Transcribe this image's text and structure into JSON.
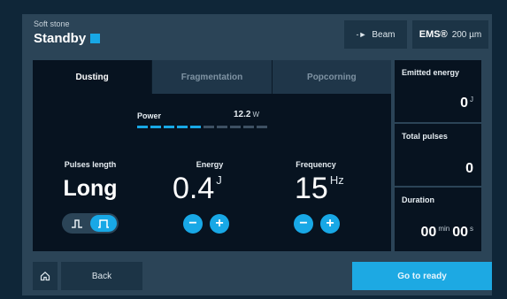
{
  "header": {
    "subtitle": "Soft stone",
    "status": "Standby",
    "beam_label": "Beam",
    "ems_logo": "EMS®",
    "fiber_size": "200 µm"
  },
  "tabs": [
    {
      "label": "Dusting",
      "active": true
    },
    {
      "label": "Fragmentation",
      "active": false
    },
    {
      "label": "Popcorning",
      "active": false
    }
  ],
  "power": {
    "label": "Power",
    "value": "12.2",
    "unit": "W",
    "segments_total": 10,
    "segments_on": 5
  },
  "pulse_length": {
    "label": "Pulses length",
    "value": "Long",
    "options": [
      "short-pulse",
      "long-pulse"
    ],
    "selected": "long-pulse"
  },
  "energy": {
    "label": "Energy",
    "value": "0.4",
    "unit": "J"
  },
  "frequency": {
    "label": "Frequency",
    "value": "15",
    "unit": "Hz"
  },
  "stats": {
    "emitted_energy": {
      "label": "Emitted energy",
      "value": "0",
      "unit": "J"
    },
    "total_pulses": {
      "label": "Total pulses",
      "value": "0"
    },
    "duration": {
      "label": "Duration",
      "minutes": "00",
      "min_unit": "min",
      "seconds": "00",
      "sec_unit": "s"
    }
  },
  "footer": {
    "back_label": "Back",
    "ready_label": "Go to ready"
  },
  "colors": {
    "accent": "#18a8e6",
    "background": "#2b4457",
    "panel": "#071320"
  },
  "icons": {
    "home": "home-icon",
    "beam": "beam-arrow-icon",
    "minus": "minus-icon",
    "plus": "plus-icon"
  }
}
